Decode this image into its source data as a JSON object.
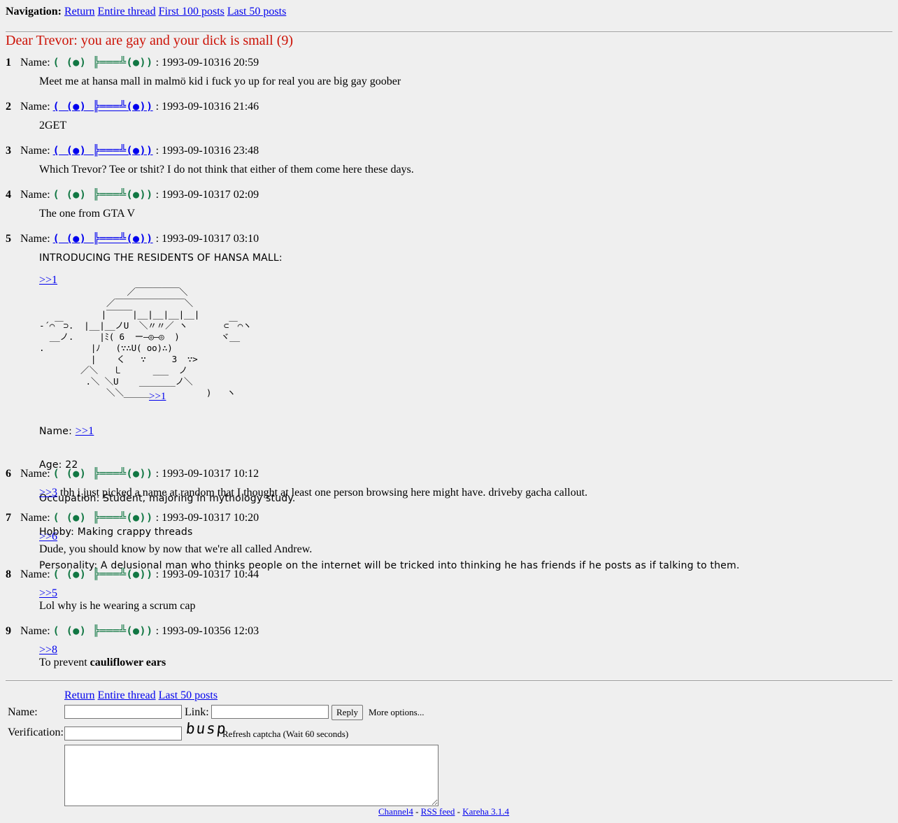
{
  "nav": {
    "label": "Navigation:",
    "links": [
      "Return",
      "Entire thread",
      "First 100 posts",
      "Last 50 posts"
    ]
  },
  "thread": {
    "title": "Dear Trevor: you are gay and your dick is small (9)"
  },
  "name_label": "Name:",
  "trip": "( (●) ╠═══╩(●))",
  "posts": [
    {
      "num": "1",
      "date": ": 1993-09-10316 20:59",
      "body": "Meet me at hansa mall in malmö kid i fuck yo up for real you are big gay goober"
    },
    {
      "num": "2",
      "date": ": 1993-09-10316 21:46",
      "body": "2GET"
    },
    {
      "num": "3",
      "date": ": 1993-09-10316 23:48",
      "body": "Which Trevor? Tee or tshit? I do not think that either of them come here these days."
    },
    {
      "num": "4",
      "date": ": 1993-09-10317 02:09",
      "body": "The one from GTA V"
    },
    {
      "num": "5",
      "date": ": 1993-09-10317 03:10",
      "intro": "INTRODUCING THE RESIDENTS OF HANSA MALL:",
      "quote": ">>1",
      "art_link": ">>1",
      "profile": {
        "name_label": "Name:",
        "name_link": ">>1",
        "age": "Age: 22",
        "occupation": "Occupation: Student, majoring in mythology study.",
        "hobby": "Hobby: Making crappy threads",
        "personality": "Personality: A delusional man who thinks people on the internet will be tricked into thinking he has friends if he posts as if talking to them."
      }
    },
    {
      "num": "6",
      "date": ": 1993-09-10317 10:12",
      "quote": ">>3",
      "body": " tbh i just picked a name at random that I thought at least one person browsing here might have. driveby gacha callout."
    },
    {
      "num": "7",
      "date": ": 1993-09-10317 10:20",
      "quote": ">>6",
      "body": "Dude, you should know by now that we're all called Andrew."
    },
    {
      "num": "8",
      "date": ": 1993-09-10317 10:44",
      "quote": ">>5",
      "body": "Lol why is he wearing a scrum cap"
    },
    {
      "num": "9",
      "date": ": 1993-09-10356 12:03",
      "quote": ">>8",
      "body_prefix": "To prevent ",
      "body_bold": "cauliflower ears"
    }
  ],
  "form": {
    "links": [
      "Return",
      "Entire thread",
      "Last 50 posts"
    ],
    "name_label": "Name:",
    "link_label": "Link:",
    "reply_button": "Reply",
    "more_options": "More options...",
    "verification_label": "Verification:",
    "captcha_text": "busp",
    "refresh_captcha": "Refresh captcha",
    "wait_text": " (Wait 60 seconds)"
  },
  "footer": {
    "links": [
      "Channel4",
      "RSS feed",
      "Kareha 3.1.4"
    ],
    "separator": " - "
  }
}
